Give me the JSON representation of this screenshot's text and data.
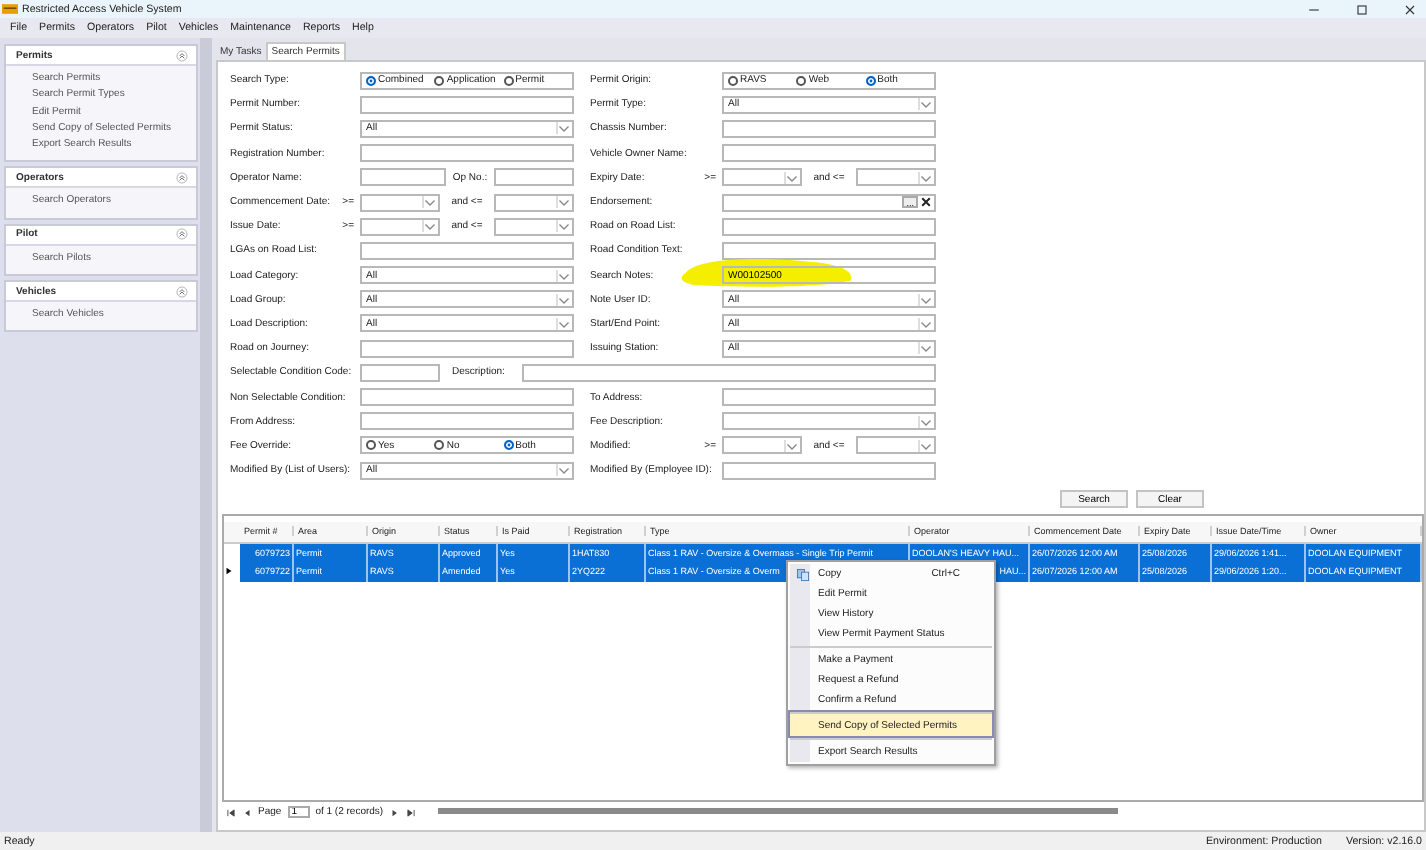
{
  "window": {
    "title": "Restricted Access Vehicle System"
  },
  "menu": [
    "File",
    "Permits",
    "Operators",
    "Pilot",
    "Vehicles",
    "Maintenance",
    "Reports",
    "Help"
  ],
  "sidebar": [
    {
      "title": "Permits",
      "items": [
        "Search Permits",
        "Search Permit Types",
        "Edit Permit",
        "Send Copy of Selected Permits",
        "Export Search Results"
      ]
    },
    {
      "title": "Operators",
      "items": [
        "Search Operators"
      ]
    },
    {
      "title": "Pilot",
      "items": [
        "Search Pilots"
      ]
    },
    {
      "title": "Vehicles",
      "items": [
        "Search Vehicles"
      ]
    }
  ],
  "tabs": [
    {
      "label": "My Tasks",
      "selected": false
    },
    {
      "label": "Search Permits",
      "selected": true
    }
  ],
  "form": [
    {
      "left": {
        "label": "Search Type:",
        "kind": "radio",
        "options": [
          {
            "label": "Combined",
            "selected": true
          },
          {
            "label": "Application",
            "selected": false
          },
          {
            "label": "Permit",
            "selected": false
          }
        ]
      },
      "right": {
        "label": "Permit Origin:",
        "kind": "radio",
        "options": [
          {
            "label": "RAVS",
            "selected": false
          },
          {
            "label": "Web",
            "selected": false
          },
          {
            "label": "Both",
            "selected": true
          }
        ]
      }
    },
    {
      "left": {
        "label": "Permit Number:",
        "kind": "text"
      },
      "right": {
        "label": "Permit Type:",
        "kind": "select",
        "value": "All"
      }
    },
    {
      "left": {
        "label": "Permit Status:",
        "kind": "select",
        "value": "All"
      },
      "right": {
        "label": "Chassis Number:",
        "kind": "text"
      }
    },
    {
      "left": {
        "label": "Registration Number:",
        "kind": "text"
      },
      "right": {
        "label": "Vehicle Owner Name:",
        "kind": "text"
      }
    },
    {
      "left": {
        "label": "Operator Name:",
        "kind": "text_pair",
        "second_label": "Op No.:"
      },
      "right": {
        "label": "Expiry Date:",
        "kind": "range",
        "from_op": ">=",
        "to_op": "and <="
      }
    },
    {
      "left": {
        "label": "Commencement Date:",
        "kind": "range",
        "from_op": ">=",
        "to_op": "and <="
      },
      "right": {
        "label": "Endorsement:",
        "kind": "picker",
        "button": "..."
      }
    },
    {
      "left": {
        "label": "Issue Date:",
        "kind": "range",
        "from_op": ">=",
        "to_op": "and <="
      },
      "right": {
        "label": "Road on Road List:",
        "kind": "text"
      }
    },
    {
      "left": {
        "label": "LGAs on Road List:",
        "kind": "text"
      },
      "right": {
        "label": "Road Condition Text:",
        "kind": "text"
      }
    },
    {
      "left": {
        "label": "Load Category:",
        "kind": "select",
        "value": "All"
      },
      "right": {
        "label": "Search Notes:",
        "kind": "text",
        "value": "W00102500",
        "highlighted": true
      }
    },
    {
      "left": {
        "label": "Load Group:",
        "kind": "select",
        "value": "All"
      },
      "right": {
        "label": "Note User ID:",
        "kind": "select",
        "value": "All"
      }
    },
    {
      "left": {
        "label": "Load Description:",
        "kind": "select",
        "value": "All"
      },
      "right": {
        "label": "Start/End Point:",
        "kind": "select",
        "value": "All"
      }
    },
    {
      "left": {
        "label": "Road on Journey:",
        "kind": "text"
      },
      "right": {
        "label": "Issuing Station:",
        "kind": "select",
        "value": "All"
      }
    },
    {
      "left": {
        "label": "Selectable Condition Code:",
        "kind": "code_description",
        "second_label": "Description:"
      }
    },
    {
      "left": {
        "label": "Non Selectable Condition:",
        "kind": "text"
      },
      "right": {
        "label": "To Address:",
        "kind": "text"
      }
    },
    {
      "left": {
        "label": "From Address:",
        "kind": "text"
      },
      "right": {
        "label": "Fee Description:",
        "kind": "select"
      }
    },
    {
      "left": {
        "label": "Fee Override:",
        "kind": "radio",
        "options": [
          {
            "label": "Yes",
            "selected": false
          },
          {
            "label": "No",
            "selected": false
          },
          {
            "label": "Both",
            "selected": true
          }
        ]
      },
      "right": {
        "label": "Modified:",
        "kind": "range",
        "from_op": ">=",
        "to_op": "and <="
      }
    },
    {
      "left": {
        "label": "Modified By (List of Users):",
        "kind": "select",
        "value": "All"
      },
      "right": {
        "label": "Modified By (Employee ID):",
        "kind": "text"
      }
    }
  ],
  "buttons": [
    "Search",
    "Clear"
  ],
  "table": {
    "columns": [
      "Permit #",
      "Area",
      "Origin",
      "Status",
      "Is Paid",
      "Registration",
      "Type",
      "Operator",
      "Commencement Date",
      "Expiry Date",
      "Issue Date/Time",
      "Owner"
    ],
    "rows": [
      {
        "selected": true,
        "current": false,
        "cells": [
          "6079723",
          "Permit",
          "RAVS",
          "Approved",
          "Yes",
          "1HAT830",
          "Class 1 RAV - Oversize & Overmass - Single Trip Permit",
          "DOOLAN'S HEAVY HAU...",
          "26/07/2026 12:00 AM",
          "25/08/2026",
          "29/06/2026 1:41...",
          "DOOLAN EQUIPMENT"
        ]
      },
      {
        "selected": true,
        "current": true,
        "cells": [
          "6079722",
          "Permit",
          "RAVS",
          "Amended",
          "Yes",
          "2YQ222",
          "Class 1 RAV - Oversize & Overm",
          {
            "text": "HAU...",
            "cut_left": true
          },
          "26/07/2026 12:00 AM",
          "25/08/2026",
          "29/06/2026 1:20...",
          "DOOLAN EQUIPMENT"
        ]
      }
    ]
  },
  "context_menu": [
    {
      "label": "Copy",
      "shortcut": "Ctrl+C",
      "icon": true,
      "separator_before": false,
      "selected": false
    },
    {
      "label": "Edit Permit",
      "separator_before": false,
      "selected": false
    },
    {
      "label": "View History",
      "separator_before": false,
      "selected": false
    },
    {
      "label": "View Permit Payment Status",
      "separator_before": false,
      "selected": false
    },
    {
      "label": "Make a Payment",
      "separator_before": true,
      "selected": false
    },
    {
      "label": "Request a Refund",
      "separator_before": false,
      "selected": false
    },
    {
      "label": "Confirm a Refund",
      "separator_before": false,
      "selected": false
    },
    {
      "label": "Send Copy of Selected Permits",
      "separator_before": true,
      "selected": true
    },
    {
      "label": "Export Search Results",
      "separator_before": true,
      "selected": false
    }
  ],
  "pager": {
    "label": "Page",
    "page": "1",
    "of": "of 1 (2 records)"
  },
  "status_bar": {
    "left": "Ready",
    "environment": "Environment: Production",
    "version": "Version: v2.16.0"
  }
}
